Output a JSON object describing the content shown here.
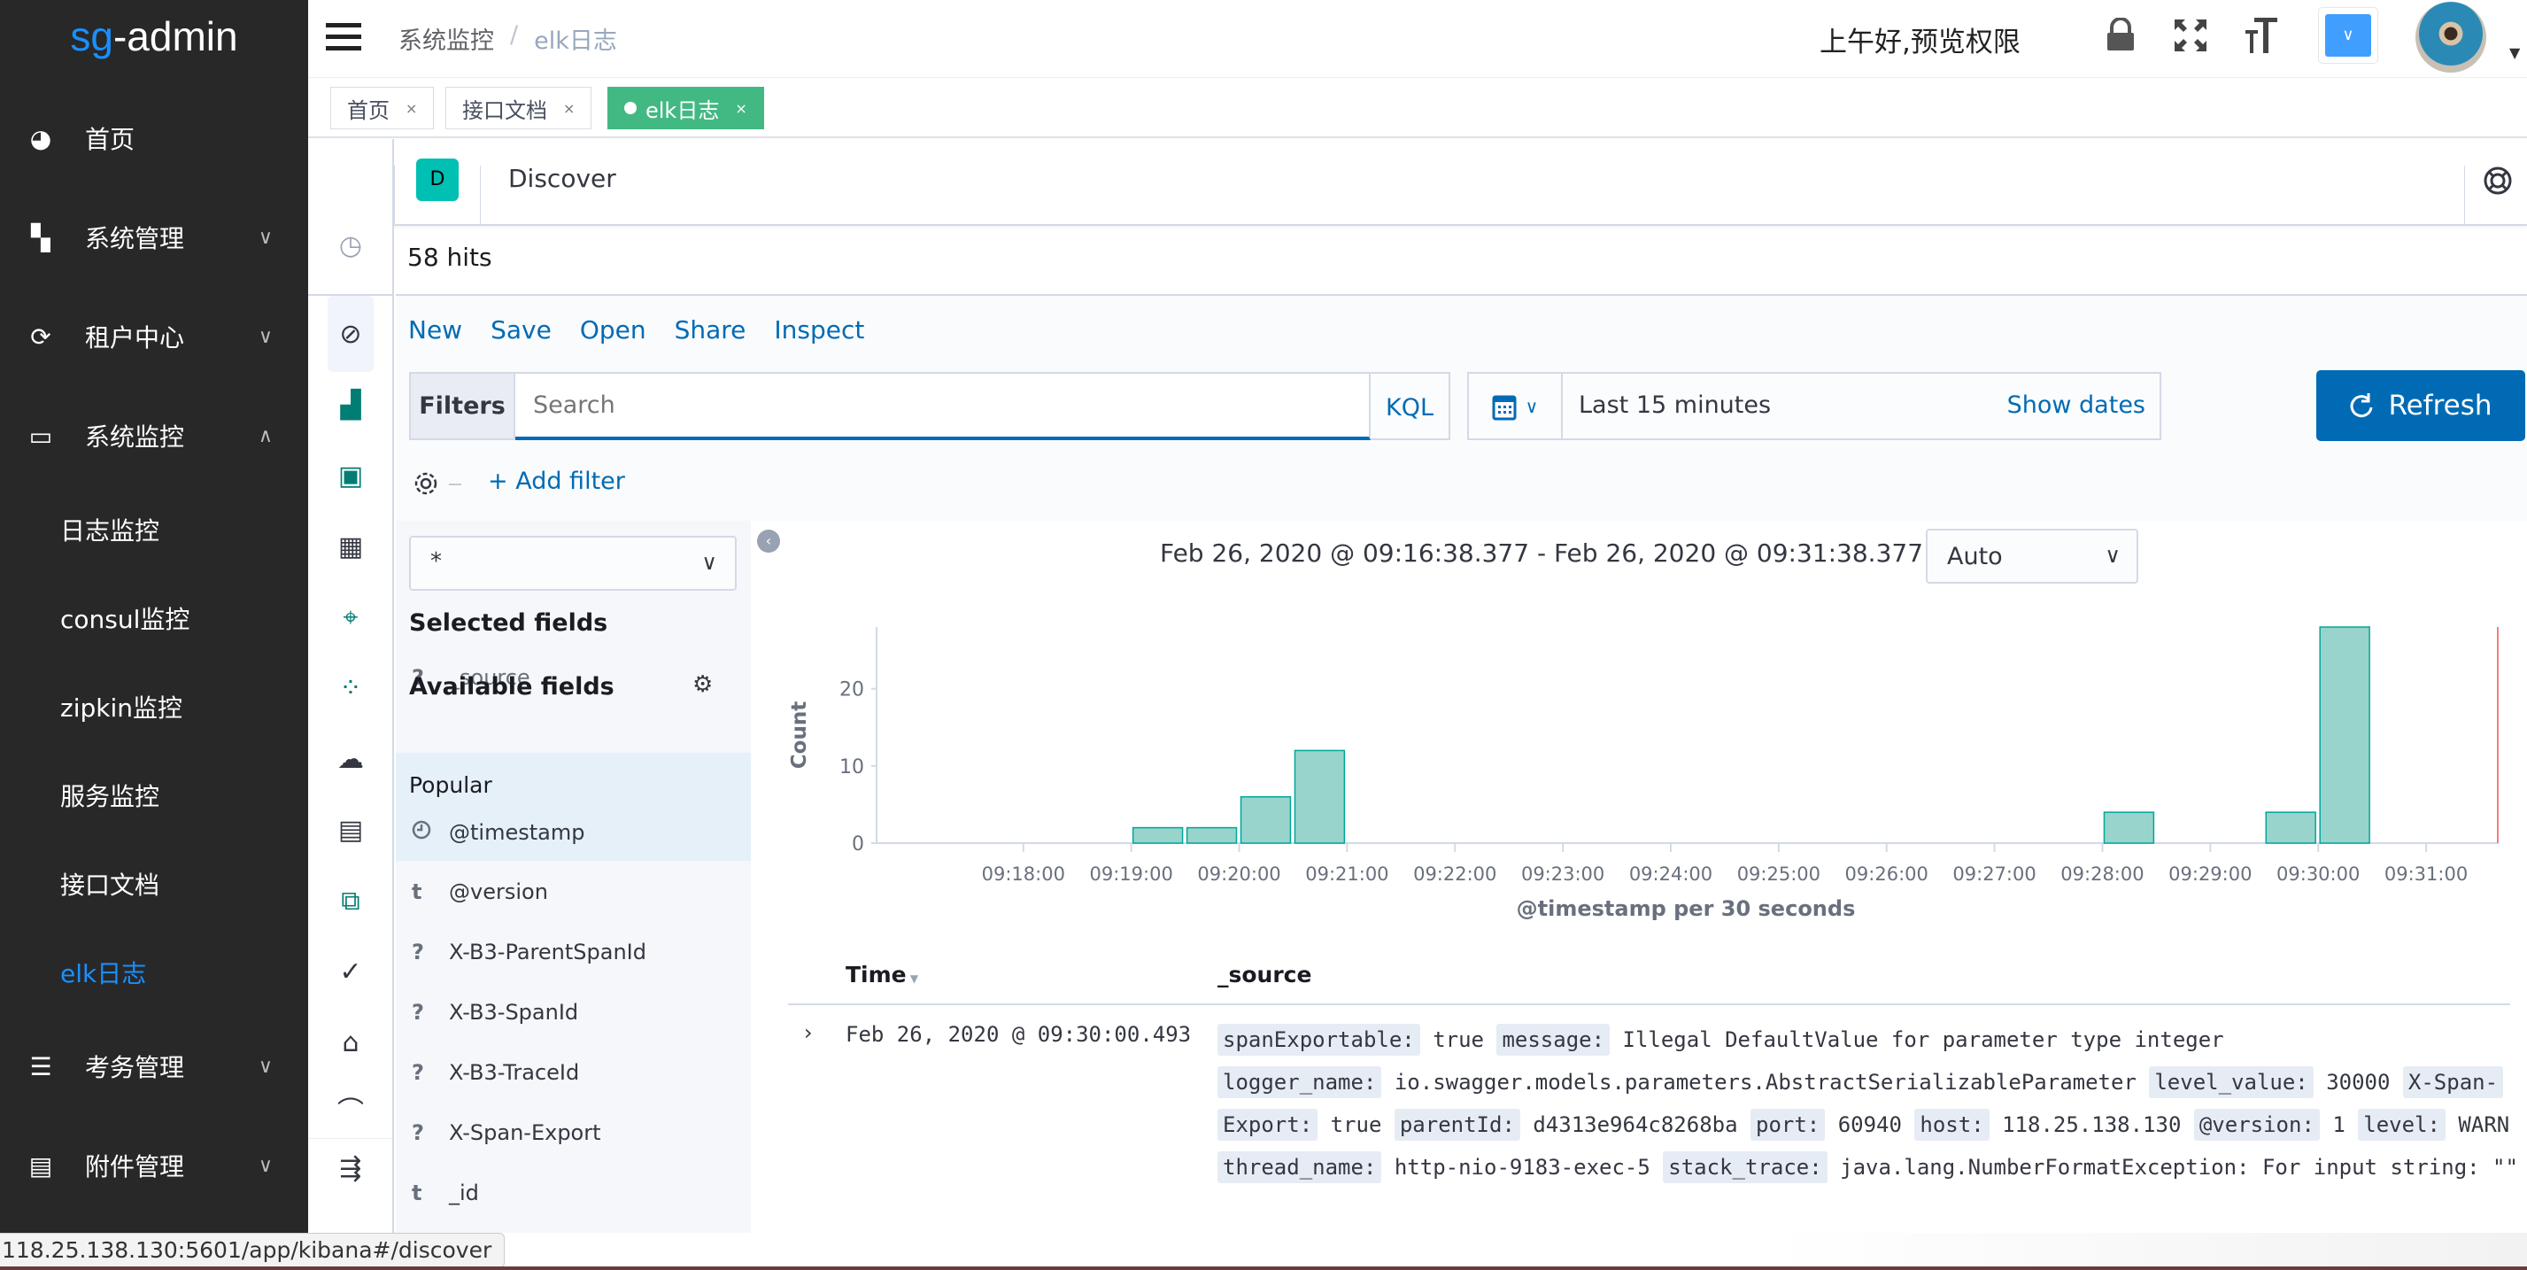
{
  "app": {
    "logo_prefix": "sg",
    "logo_suffix": "-admin"
  },
  "sidebar": {
    "items": [
      {
        "label": "首页",
        "icon": "dashboard-icon"
      },
      {
        "label": "系统管理",
        "icon": "grid-icon",
        "expandable": true
      },
      {
        "label": "租户中心",
        "icon": "tenant-icon",
        "expandable": true
      },
      {
        "label": "系统监控",
        "icon": "monitor-icon",
        "expanded": true
      },
      {
        "label": "日志监控"
      },
      {
        "label": "consul监控"
      },
      {
        "label": "zipkin监控"
      },
      {
        "label": "服务监控"
      },
      {
        "label": "接口文档"
      },
      {
        "label": "elk日志",
        "active": true
      },
      {
        "label": "考务管理",
        "icon": "list-icon",
        "expandable": true
      },
      {
        "label": "附件管理",
        "icon": "file-icon",
        "expandable": true
      }
    ]
  },
  "header": {
    "breadcrumb": [
      "系统监控",
      "elk日志"
    ],
    "separator": "/",
    "greeting": "上午好,预览权限"
  },
  "tabs": [
    {
      "label": "首页"
    },
    {
      "label": "接口文档"
    },
    {
      "label": "elk日志",
      "active": true
    }
  ],
  "kibana": {
    "app_badge": "D",
    "app_title": "Discover",
    "hits": "58 hits",
    "menu": [
      "New",
      "Save",
      "Open",
      "Share",
      "Inspect"
    ],
    "filters_label": "Filters",
    "search_placeholder": "Search",
    "kql": "KQL",
    "time_range": "Last 15 minutes",
    "show_dates": "Show dates",
    "refresh": "Refresh",
    "add_filter": "+ Add filter",
    "index_pattern": "*",
    "selected_fields_title": "Selected fields",
    "selected_fields": [
      {
        "type": "?",
        "name": "_source"
      }
    ],
    "available_fields_title": "Available fields",
    "popular_label": "Popular",
    "popular_fields": [
      {
        "type": "clock",
        "name": "@timestamp"
      }
    ],
    "fields": [
      {
        "type": "t",
        "name": "@version"
      },
      {
        "type": "?",
        "name": "X-B3-ParentSpanId"
      },
      {
        "type": "?",
        "name": "X-B3-SpanId"
      },
      {
        "type": "?",
        "name": "X-B3-TraceId"
      },
      {
        "type": "?",
        "name": "X-Span-Export"
      },
      {
        "type": "t",
        "name": "_id"
      }
    ],
    "interval": "Auto",
    "chart_range": "Feb 26, 2020 @ 09:16:38.377 - Feb 26, 2020 @ 09:31:38.377 —",
    "table": {
      "headers": [
        "Time",
        "_source"
      ],
      "rows": [
        {
          "time": "Feb 26, 2020 @ 09:30:00.493",
          "lines": [
            [
              [
                "spanExportable:",
                "true"
              ],
              [
                "message:",
                "Illegal DefaultValue for parameter type integer"
              ]
            ],
            [
              [
                "logger_name:",
                "io.swagger.models.parameters.AbstractSerializableParameter"
              ],
              [
                "level_value:",
                "30000"
              ],
              [
                "X-Span-",
                ""
              ]
            ],
            [
              [
                "Export:",
                "true"
              ],
              [
                "parentId:",
                "d4313e964c8268ba"
              ],
              [
                "port:",
                "60940"
              ],
              [
                "host:",
                "118.25.138.130"
              ],
              [
                "@version:",
                "1"
              ],
              [
                "level:",
                "WARN"
              ]
            ],
            [
              [
                "thread_name:",
                "http-nio-9183-exec-5"
              ],
              [
                "stack_trace:",
                "java.lang.NumberFormatException: For input string: \"\""
              ]
            ]
          ]
        }
      ]
    }
  },
  "status_url": "118.25.138.130:5601/app/kibana#/discover",
  "colors": {
    "sidebar_bg": "#282828",
    "accent": "#1890ff",
    "tab_active": "#42b983",
    "kibana_blue": "#006bb4",
    "bar_fill": "#98d4cc",
    "bar_stroke": "#00a69b"
  },
  "chart_data": {
    "type": "bar",
    "xlabel": "@timestamp per 30 seconds",
    "ylabel": "Count",
    "x_range": [
      "09:16:38.377",
      "09:31:38.377"
    ],
    "ylim": [
      0,
      28
    ],
    "y_ticks": [
      0,
      10,
      20
    ],
    "x_ticks": [
      "09:18:00",
      "09:19:00",
      "09:20:00",
      "09:21:00",
      "09:22:00",
      "09:23:00",
      "09:24:00",
      "09:25:00",
      "09:26:00",
      "09:27:00",
      "09:28:00",
      "09:29:00",
      "09:30:00",
      "09:31:00"
    ],
    "categories": [
      "09:19:00",
      "09:19:30",
      "09:20:00",
      "09:20:30",
      "09:28:00",
      "09:29:30",
      "09:30:00"
    ],
    "values": [
      2,
      2,
      6,
      12,
      4,
      4,
      28
    ]
  }
}
